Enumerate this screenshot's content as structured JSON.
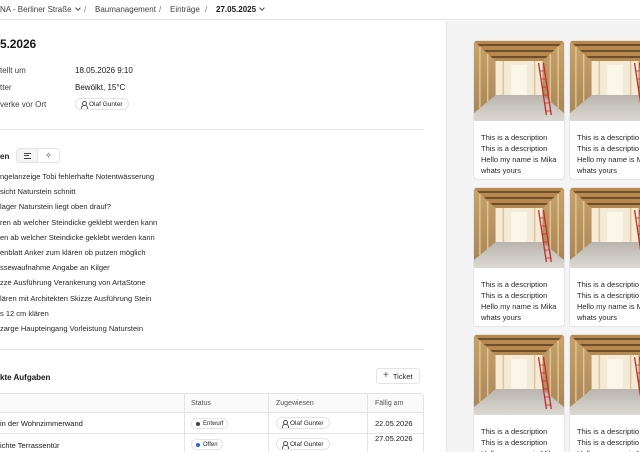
{
  "breadcrumb": {
    "project": "NA - Berliner Straße",
    "module": "Baumanagement",
    "section": "Einträge",
    "date": "27.05.2025"
  },
  "page_title": "5.2026",
  "meta": [
    {
      "label": "tellt um",
      "value": "18.05.2026 9:10"
    },
    {
      "label": "tter",
      "value": "Bewölkt, 15°C"
    },
    {
      "label": "verke vor Ort",
      "chip": "Olaf Gunter"
    }
  ],
  "entries_section": {
    "title": "en",
    "items": [
      "ngelanzeige Tobi fehlerhafte Notentwässerung",
      "sicht Naturstein schnitt",
      "lager Naturstein liegt oben drauf?",
      "ren ab welcher Steindicke geklebt werden kann",
      "en ab welcher Steindicke geklebt werden kann",
      "enblatt Anker zum klären ob putzen möglich",
      "ssewaufnahme Angabe an Kilger",
      "zze Ausführung Verankerung von ArtaStone",
      "lären mit Architekten Skizze Ausführung Stein",
      "s 12 cm klären",
      "zarge Haupteingang Vorleistung Naturstein"
    ]
  },
  "tasks_section": {
    "title": "kte Aufgaben",
    "ticket_button": "Ticket",
    "columns": [
      "",
      "Status",
      "Zugewiesen",
      "Fällig am"
    ],
    "rows": [
      {
        "task": "in der Wohnzimmerwand",
        "status": "Entwurf",
        "assignee": "Olaf Gunter",
        "due": "22.05.2026"
      },
      {
        "task": "ichte Terrassentür",
        "status": "Offen",
        "assignee": "Olaf Gunter",
        "due": "27.05.2026"
      }
    ]
  },
  "gallery": {
    "cards": [
      {
        "lines": [
          "This is a description",
          "This is a description",
          "Hello my name is Mika",
          "whats yours"
        ]
      },
      {
        "lines": [
          "This is a descriptio",
          "This is a descriptio",
          "Hello my name is M",
          "whats yours"
        ]
      },
      {
        "lines": [
          "This is a description",
          "This is a description",
          "Hello my name is Mika",
          "whats yours"
        ]
      },
      {
        "lines": [
          "This is a descriptio",
          "This is a descriptio",
          "Hello my name is M",
          "whats yours"
        ]
      },
      {
        "lines": [
          "This is a description",
          "This is a description",
          "Hello my name is Mika"
        ]
      },
      {
        "lines": [
          "This is a descriptio",
          "This is a descriptio",
          "Hello my name is M"
        ]
      }
    ]
  },
  "colors": {
    "status_draft": "#3f3f46",
    "status_open": "#2563eb",
    "border": "#e4e4e7",
    "gallery_bg": "#f4f4f5"
  },
  "icons": {
    "list_view": "list-icon",
    "ai_view": "wand-icon",
    "add": "plus-icon",
    "user": "user-icon",
    "dropdown": "chevron-down-icon"
  }
}
